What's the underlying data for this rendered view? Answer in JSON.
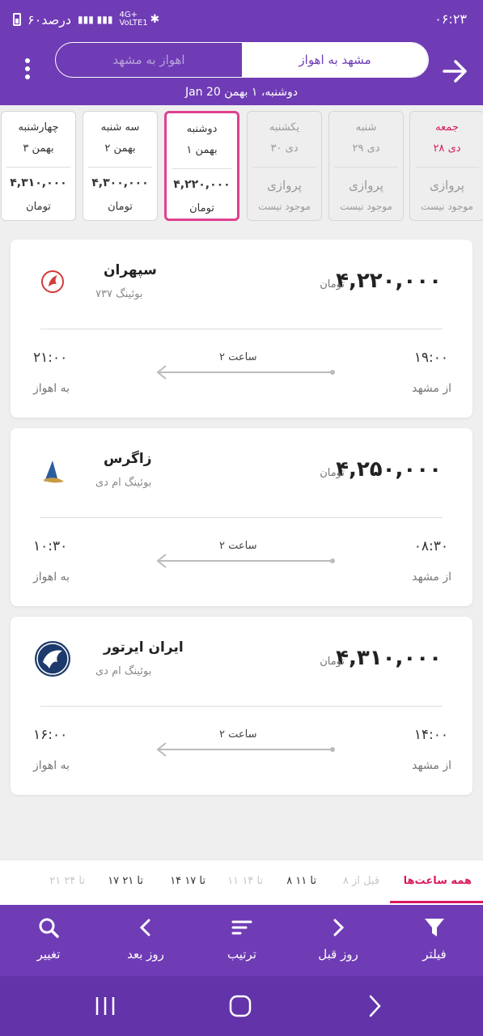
{
  "status_bar": {
    "time": "۰۶:۲۳",
    "battery_text": "۶۰درصد",
    "network": "4G+ VoLTE1"
  },
  "header": {
    "tabs": [
      {
        "label": "مشهد به اهواز",
        "active": true
      },
      {
        "label": "اهواز به مشهد",
        "active": false
      }
    ],
    "subtitle": "دوشنبه، ۱ بهمن   20 Jan"
  },
  "date_cards": [
    {
      "day": "جمعه",
      "date": "۲۸ دی",
      "price": "",
      "currency": "",
      "no_flight_1": "پروازی",
      "no_flight_2": "موجود نیست",
      "state": "disabled",
      "highlight": "friday"
    },
    {
      "day": "شنبه",
      "date": "۲۹ دی",
      "price": "",
      "currency": "",
      "no_flight_1": "پروازی",
      "no_flight_2": "موجود نیست",
      "state": "disabled"
    },
    {
      "day": "یکشنبه",
      "date": "۳۰ دی",
      "price": "",
      "currency": "",
      "no_flight_1": "پروازی",
      "no_flight_2": "موجود نیست",
      "state": "disabled"
    },
    {
      "day": "دوشنبه",
      "date": "۱ بهمن",
      "price": "۴,۲۲۰,۰۰۰",
      "currency": "تومان",
      "state": "selected"
    },
    {
      "day": "سه شنبه",
      "date": "۲ بهمن",
      "price": "۴,۳۰۰,۰۰۰",
      "currency": "تومان",
      "state": "available"
    },
    {
      "day": "چهارشنبه",
      "date": "۳ بهمن",
      "price": "۴,۳۱۰,۰۰۰",
      "currency": "تومان",
      "state": "available"
    }
  ],
  "flights": [
    {
      "airline": "سپهران",
      "aircraft": "بوئینگ ۷۳۷",
      "price": "۴,۲۲۰,۰۰۰",
      "currency": "تومان",
      "departure": "۱۹:۰۰",
      "arrival": "۲۱:۰۰",
      "duration": "۲ ساعت",
      "from": "از مشهد",
      "to": "به اهواز",
      "logo": "sepehran-logo"
    },
    {
      "airline": "زاگرس",
      "aircraft": "بوئینگ ام دی",
      "price": "۴,۲۵۰,۰۰۰",
      "currency": "تومان",
      "departure": "۰۸:۳۰",
      "arrival": "۱۰:۳۰",
      "duration": "۲ ساعت",
      "from": "از مشهد",
      "to": "به اهواز",
      "logo": "zagros-logo"
    },
    {
      "airline": "ایران ایرتور",
      "aircraft": "بوئینگ ام دی",
      "price": "۴,۳۱۰,۰۰۰",
      "currency": "تومان",
      "departure": "۱۴:۰۰",
      "arrival": "۱۶:۰۰",
      "duration": "۲ ساعت",
      "from": "از مشهد",
      "to": "به اهواز",
      "logo": "iran-airtour-logo"
    }
  ],
  "hour_filters": [
    {
      "label": "همه ساعت‌ها",
      "state": "active"
    },
    {
      "label": "قبل از ۸",
      "state": "dim"
    },
    {
      "label": "۸ تا ۱۱",
      "state": "normal"
    },
    {
      "label": "۱۱ تا ۱۴",
      "state": "dim"
    },
    {
      "label": "۱۴ تا ۱۷",
      "state": "normal"
    },
    {
      "label": "۱۷ تا ۲۱",
      "state": "normal"
    },
    {
      "label": "۲۱ تا ۲۴",
      "state": "dim"
    }
  ],
  "bottom_bar": [
    {
      "label": "فیلتر",
      "icon": "filter-icon"
    },
    {
      "label": "روز قبل",
      "icon": "chevron-right-icon"
    },
    {
      "label": "ترتیب",
      "icon": "sort-icon"
    },
    {
      "label": "روز بعد",
      "icon": "chevron-left-icon"
    },
    {
      "label": "تغییر",
      "icon": "search-icon"
    }
  ],
  "colors": {
    "primary": "#6f3cb5",
    "accent": "#d81b60",
    "selected_border": "#e0418f",
    "background": "#efefef"
  }
}
